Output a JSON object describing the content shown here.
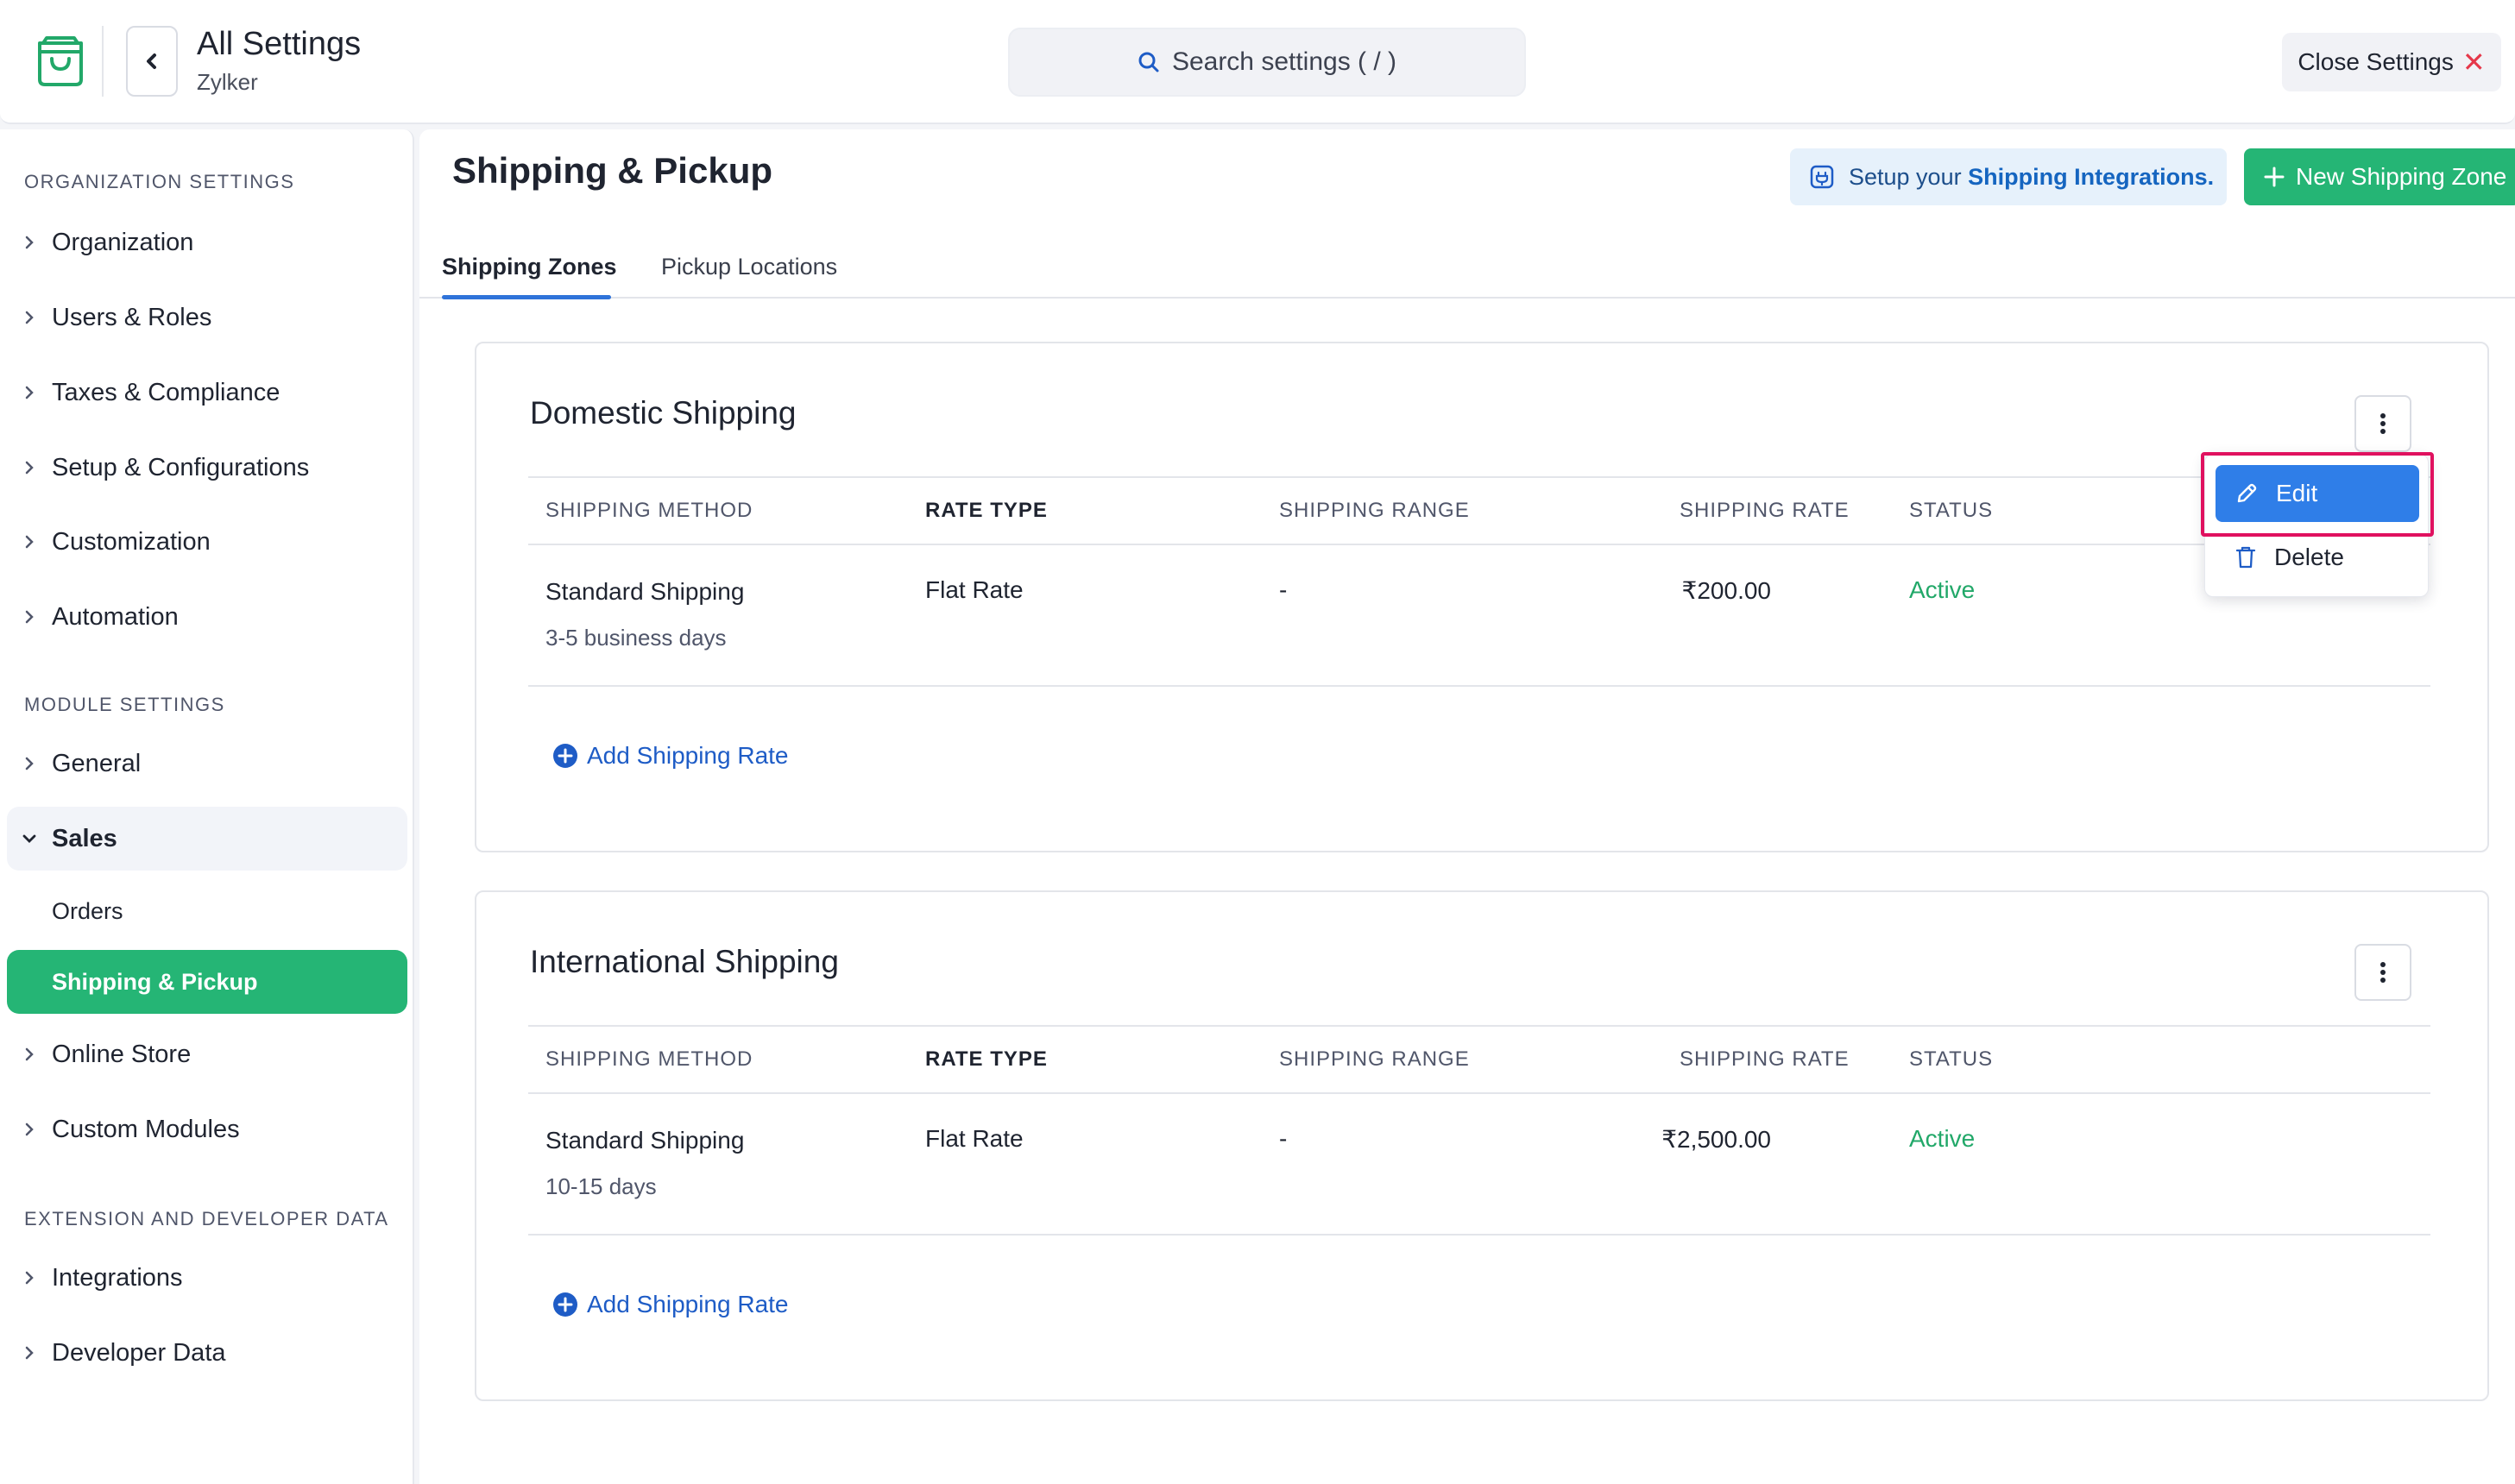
{
  "header": {
    "title": "All Settings",
    "subtitle": "Zylker",
    "search_placeholder": "Search settings ( / )",
    "close_label": "Close Settings"
  },
  "sidebar": {
    "org_section": "ORGANIZATION SETTINGS",
    "org_items": [
      "Organization",
      "Users & Roles",
      "Taxes & Compliance",
      "Setup & Configurations",
      "Customization",
      "Automation"
    ],
    "module_section": "MODULE SETTINGS",
    "general": "General",
    "sales": "Sales",
    "sales_sub": [
      "Orders",
      "Shipping & Pickup"
    ],
    "online_store": "Online Store",
    "custom_modules": "Custom Modules",
    "ext_section": "EXTENSION AND DEVELOPER DATA",
    "ext_items": [
      "Integrations",
      "Developer Data"
    ]
  },
  "main": {
    "title": "Shipping & Pickup",
    "integrations_prefix": "Setup your ",
    "integrations_bold": "Shipping Integrations.",
    "new_zone_label": "New Shipping Zone",
    "tabs": [
      "Shipping Zones",
      "Pickup Locations"
    ],
    "columns": [
      "SHIPPING METHOD",
      "RATE TYPE",
      "SHIPPING RANGE",
      "SHIPPING RATE",
      "STATUS"
    ],
    "add_rate_label": "Add Shipping Rate",
    "zones": [
      {
        "name": "Domestic Shipping",
        "method": "Standard Shipping",
        "duration": "3-5 business days",
        "rate_type": "Flat Rate",
        "range": "-",
        "rate": "₹200.00",
        "status": "Active"
      },
      {
        "name": "International Shipping",
        "method": "Standard Shipping",
        "duration": "10-15 days",
        "rate_type": "Flat Rate",
        "range": "-",
        "rate": "₹2,500.00",
        "status": "Active"
      }
    ],
    "menu": {
      "edit": "Edit",
      "delete": "Delete"
    }
  },
  "colors": {
    "brand_green": "#25b575",
    "link_blue": "#1e5cc6",
    "status_active": "#22a869",
    "highlight": "#e0115f"
  }
}
